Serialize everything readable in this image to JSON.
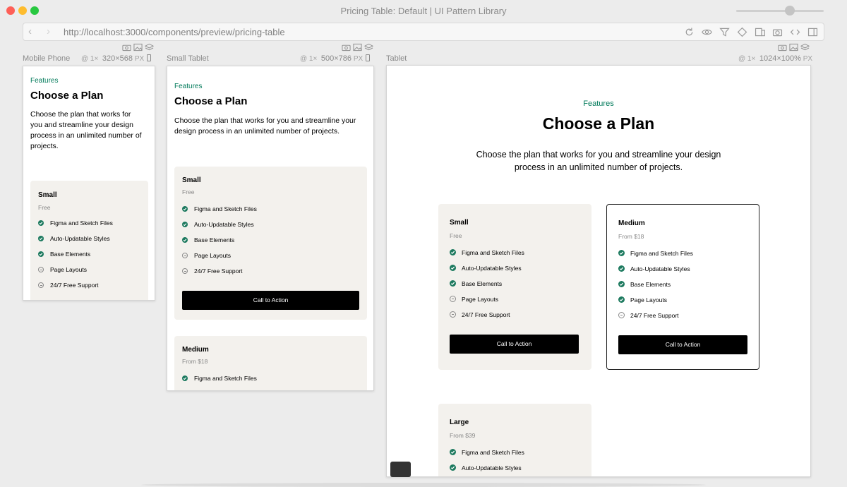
{
  "window": {
    "title": "Pricing Table: Default | UI Pattern Library",
    "zoom_level": 0.85
  },
  "toolbar": {
    "url": "http://localhost:3000/components/preview/pricing-table",
    "icons": [
      "reload-icon",
      "eye-icon",
      "filter-icon",
      "layers-icon",
      "devices-icon",
      "camera-icon",
      "code-icon",
      "sidebar-icon"
    ]
  },
  "devices": [
    {
      "label": "Mobile Phone",
      "scale": "@ 1×",
      "size": "320×568",
      "unit": "PX"
    },
    {
      "label": "Small Tablet",
      "scale": "@ 1×",
      "size": "500×786",
      "unit": "PX"
    },
    {
      "label": "Tablet",
      "scale": "@ 1×",
      "size": "1024×100%",
      "unit": "PX"
    }
  ],
  "content": {
    "eyebrow": "Features",
    "title": "Choose a Plan",
    "description": "Choose the plan that works for you and streamline your design process in an unlimited number of projects.",
    "mobile_description_lines": [
      "Choose the plan that works for",
      "you and streamline your design",
      "process in an unlimited number of",
      "projects."
    ],
    "smalltab_description_lines": [
      "Choose the plan that works for you and streamline your",
      "design process in an unlimited number of projects."
    ],
    "tablet_description_lines": [
      "Choose the plan that works for you and streamline your design",
      "process in an unlimited number of projects."
    ],
    "cta_label": "Call to Action",
    "plans": [
      {
        "name": "Small",
        "price": "Free",
        "features": [
          {
            "label": "Figma and Sketch Files",
            "included": true
          },
          {
            "label": "Auto-Updatable Styles",
            "included": true
          },
          {
            "label": "Base Elements",
            "included": true
          },
          {
            "label": "Page Layouts",
            "included": false
          },
          {
            "label": "24/7 Free Support",
            "included": false
          }
        ]
      },
      {
        "name": "Medium",
        "price": "From $18",
        "features": [
          {
            "label": "Figma and Sketch Files",
            "included": true
          },
          {
            "label": "Auto-Updatable Styles",
            "included": true
          },
          {
            "label": "Base Elements",
            "included": true
          },
          {
            "label": "Page Layouts",
            "included": true
          },
          {
            "label": "24/7 Free Support",
            "included": false
          }
        ]
      },
      {
        "name": "Large",
        "price": "From $39",
        "features": [
          {
            "label": "Figma and Sketch Files",
            "included": true
          },
          {
            "label": "Auto-Updatable Styles",
            "included": true
          }
        ]
      }
    ]
  },
  "colors": {
    "accent": "#007a5a",
    "check": "#1d7a5f",
    "card_bg": "#f3f1ed",
    "cta_bg": "#000000"
  }
}
